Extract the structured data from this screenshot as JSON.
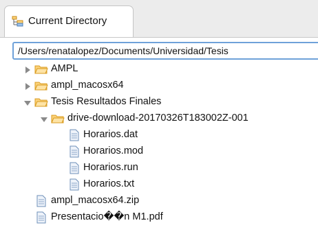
{
  "tab": {
    "label": "Current Directory",
    "icon": "folder-tree-icon"
  },
  "path": {
    "value": "/Users/renatalopez/Documents/Universidad/Tesis"
  },
  "tree": [
    {
      "label": "AMPL",
      "type": "folder",
      "expanded": false
    },
    {
      "label": "ampl_macosx64",
      "type": "folder",
      "expanded": false
    },
    {
      "label": "Tesis Resultados Finales",
      "type": "folder",
      "expanded": true
    },
    {
      "label": "drive-download-20170326T183002Z-001",
      "type": "folder",
      "expanded": true
    },
    {
      "label": "Horarios.dat",
      "type": "file"
    },
    {
      "label": "Horarios.mod",
      "type": "file"
    },
    {
      "label": "Horarios.run",
      "type": "file"
    },
    {
      "label": "Horarios.txt",
      "type": "file"
    },
    {
      "label": "ampl_macosx64.zip",
      "type": "file"
    },
    {
      "label": "Presentacio��n M1.pdf",
      "type": "file"
    }
  ],
  "colors": {
    "folder_fill": "#fbd27a",
    "folder_stroke": "#d99b1f",
    "file_stroke": "#6d8fb8",
    "file_fill": "#eef3fa"
  }
}
